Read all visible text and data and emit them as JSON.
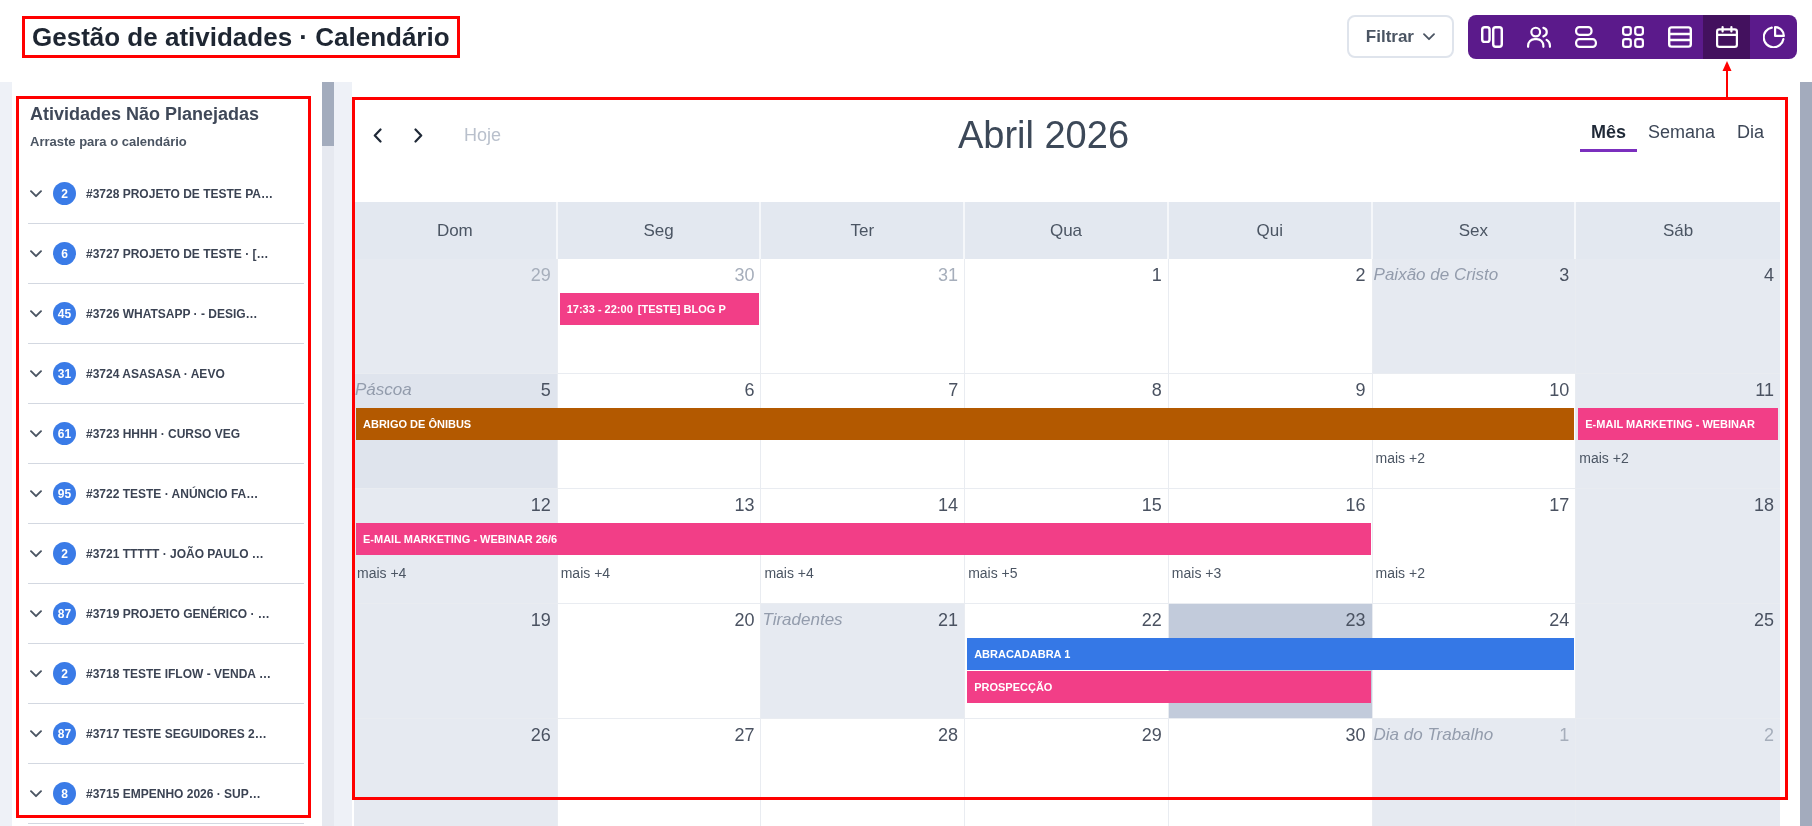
{
  "header": {
    "title": "Gestão de atividades · Calendário",
    "highlighted": true,
    "filter_button": {
      "label": "Filtrar"
    },
    "views": [
      {
        "kind": "columns",
        "selected": false,
        "arrow": false
      },
      {
        "kind": "users",
        "selected": false,
        "arrow": false
      },
      {
        "kind": "stacked",
        "selected": false,
        "arrow": false
      },
      {
        "kind": "grid",
        "selected": false,
        "arrow": false
      },
      {
        "kind": "list",
        "selected": false,
        "arrow": false
      },
      {
        "kind": "calendar",
        "selected": true,
        "arrow": true
      },
      {
        "kind": "pie",
        "selected": false,
        "arrow": false
      }
    ]
  },
  "sidebar": {
    "title": "Atividades Não Planejadas",
    "subtitle": "Arraste para o calendário",
    "highlighted": true,
    "items": [
      {
        "count": "2",
        "label": "#3728 PROJETO DE TESTE PA…"
      },
      {
        "count": "6",
        "label": "#3727 PROJETO DE TESTE · […"
      },
      {
        "count": "45",
        "label": "#3726 WHATSAPP · - DESIG…"
      },
      {
        "count": "31",
        "label": "#3724 ASASASA · AEVO"
      },
      {
        "count": "61",
        "label": "#3723 HHHH · CURSO VEG"
      },
      {
        "count": "95",
        "label": "#3722 TESTE · ANÚNCIO FA…"
      },
      {
        "count": "2",
        "label": "#3721 TTTTT · JOÃO PAULO …"
      },
      {
        "count": "87",
        "label": "#3719 PROJETO GENÉRICO · …"
      },
      {
        "count": "2",
        "label": "#3718 TESTE IFLOW - VENDA …"
      },
      {
        "count": "87",
        "label": "#3717 TESTE SEGUIDORES 2…"
      },
      {
        "count": "8",
        "label": "#3715 EMPENHO 2026 · SUP…"
      }
    ]
  },
  "calendar": {
    "highlighted": true,
    "today_button": {
      "label": "Hoje",
      "disabled": true
    },
    "title": "Abril 2026",
    "view_tabs": [
      {
        "label": "Mês",
        "selected": true
      },
      {
        "label": "Semana",
        "selected": false
      },
      {
        "label": "Dia",
        "selected": false
      }
    ],
    "weekdays": [
      {
        "label": "Dom",
        "weekend": true
      },
      {
        "label": "Seg",
        "weekend": false
      },
      {
        "label": "Ter",
        "weekend": false
      },
      {
        "label": "Qua",
        "weekend": false
      },
      {
        "label": "Qui",
        "weekend": false
      },
      {
        "label": "Sex",
        "weekend": false
      },
      {
        "label": "Sáb",
        "weekend": true
      }
    ],
    "weeks": [
      {
        "days": [
          {
            "date": "29",
            "outside": true,
            "today": false
          },
          {
            "date": "30",
            "outside": true,
            "today": false,
            "bars": [
              {
                "kind": "start",
                "time": "17:33 - 22:00",
                "title": "[TESTE] BLOG P",
                "color": "#f23e87"
              }
            ]
          },
          {
            "date": "31",
            "outside": true,
            "today": false
          },
          {
            "date": "1",
            "outside": false,
            "today": false
          },
          {
            "date": "2",
            "outside": false,
            "today": false
          },
          {
            "date": "3",
            "outside": false,
            "today": false,
            "holiday": "Paixão de Cristo"
          },
          {
            "date": "4",
            "outside": false,
            "today": false
          }
        ]
      },
      {
        "days": [
          {
            "date": "5",
            "outside": false,
            "today": false,
            "holiday": "Páscoa",
            "bars": [
              {
                "kind": "start",
                "title": "ABRIGO DE ÔNIBUS",
                "color": "#b35900"
              }
            ]
          },
          {
            "date": "6",
            "outside": false,
            "today": false,
            "bars": [
              {
                "kind": "continued"
              }
            ]
          },
          {
            "date": "7",
            "outside": false,
            "today": false,
            "bars": [
              {
                "kind": "continued"
              }
            ]
          },
          {
            "date": "8",
            "outside": false,
            "today": false,
            "bars": [
              {
                "kind": "continued"
              }
            ]
          },
          {
            "date": "9",
            "outside": false,
            "today": false,
            "bars": [
              {
                "kind": "continued"
              }
            ]
          },
          {
            "date": "10",
            "outside": false,
            "today": false,
            "bars": [
              {
                "kind": "continued"
              }
            ],
            "more": "mais +2"
          },
          {
            "date": "11",
            "outside": false,
            "today": false,
            "bars": [
              {
                "kind": "start",
                "title": "E-MAIL MARKETING - WEBINAR",
                "color": "#f23e87"
              }
            ],
            "more": "mais +2"
          }
        ]
      },
      {
        "days": [
          {
            "date": "12",
            "outside": false,
            "today": false,
            "bars": [
              {
                "kind": "start",
                "title": "E-MAIL MARKETING - WEBINAR 26/6",
                "color": "#f23e87"
              }
            ],
            "more": "mais +4"
          },
          {
            "date": "13",
            "outside": false,
            "today": false,
            "bars": [
              {
                "kind": "continued"
              }
            ],
            "more": "mais +4"
          },
          {
            "date": "14",
            "outside": false,
            "today": false,
            "bars": [
              {
                "kind": "continued"
              }
            ],
            "more": "mais +4"
          },
          {
            "date": "15",
            "outside": false,
            "today": false,
            "bars": [
              {
                "kind": "continued"
              }
            ],
            "more": "mais +5"
          },
          {
            "date": "16",
            "outside": false,
            "today": false,
            "bars": [
              {
                "kind": "continued"
              }
            ],
            "more": "mais +3"
          },
          {
            "date": "17",
            "outside": false,
            "today": false,
            "more": "mais +2"
          },
          {
            "date": "18",
            "outside": false,
            "today": false
          }
        ]
      },
      {
        "days": [
          {
            "date": "19",
            "outside": false,
            "today": false
          },
          {
            "date": "20",
            "outside": false,
            "today": false
          },
          {
            "date": "21",
            "outside": false,
            "today": false,
            "holiday": "Tiradentes"
          },
          {
            "date": "22",
            "outside": false,
            "today": false,
            "bars": [
              {
                "kind": "start",
                "title": "ABRACADABRA 1",
                "color": "#3578e6"
              },
              {
                "kind": "start",
                "title": "PROSPECÇÃO",
                "color": "#f23e87"
              }
            ]
          },
          {
            "date": "23",
            "outside": false,
            "today": true,
            "bars": [
              {
                "kind": "continued"
              },
              {
                "kind": "continued"
              }
            ]
          },
          {
            "date": "24",
            "outside": false,
            "today": false,
            "bars": [
              {
                "kind": "continued"
              }
            ]
          },
          {
            "date": "25",
            "outside": false,
            "today": false
          }
        ]
      },
      {
        "days": [
          {
            "date": "26",
            "outside": false,
            "today": false
          },
          {
            "date": "27",
            "outside": false,
            "today": false
          },
          {
            "date": "28",
            "outside": false,
            "today": false
          },
          {
            "date": "29",
            "outside": false,
            "today": false
          },
          {
            "date": "30",
            "outside": false,
            "today": false
          },
          {
            "date": "1",
            "outside": true,
            "today": false,
            "holiday": "Dia do Trabalho"
          },
          {
            "date": "2",
            "outside": true,
            "today": false
          }
        ]
      }
    ]
  }
}
